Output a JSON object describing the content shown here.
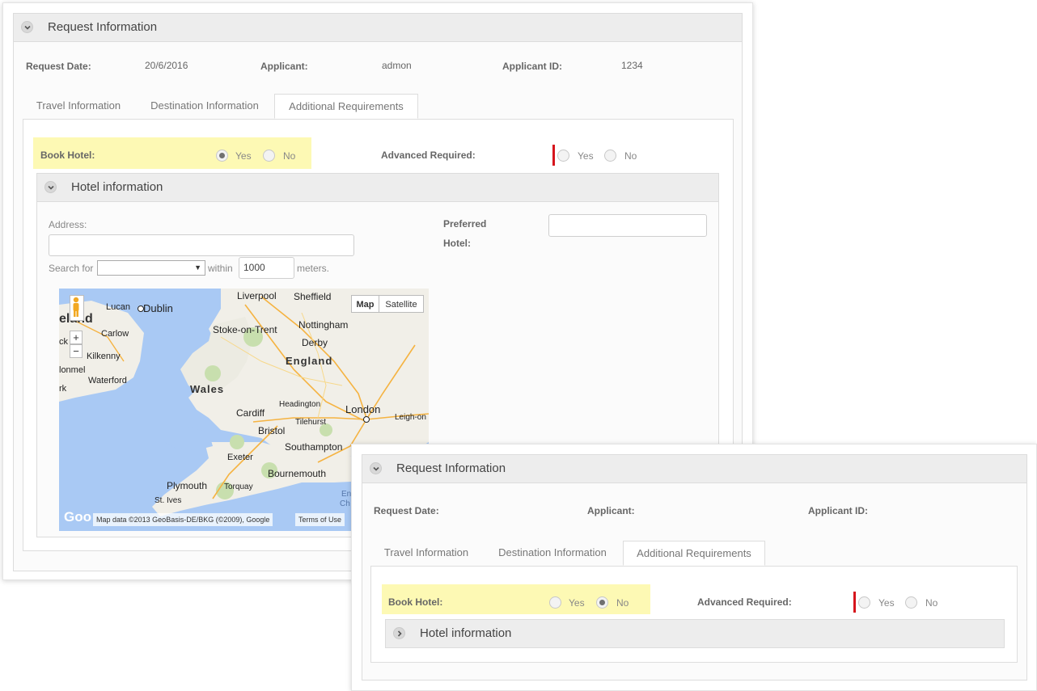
{
  "back": {
    "section_title": "Request Information",
    "fields": {
      "request_date_label": "Request Date:",
      "request_date_value": "20/6/2016",
      "applicant_label": "Applicant:",
      "applicant_value": "admon",
      "applicant_id_label": "Applicant ID:",
      "applicant_id_value": "1234"
    },
    "tabs": [
      "Travel Information",
      "Destination Information",
      "Additional Requirements"
    ],
    "active_tab": "Additional Requirements",
    "book_hotel": {
      "label": "Book Hotel:",
      "yes": "Yes",
      "no": "No",
      "selected": "Yes"
    },
    "advanced": {
      "label": "Advanced Required:",
      "yes": "Yes",
      "no": "No",
      "selected": ""
    },
    "hotel_section": {
      "title": "Hotel information",
      "address_label": "Address:",
      "address_value": "",
      "search_for_label": "Search for",
      "search_for_value": "",
      "within_label": "within",
      "within_value": "1000",
      "meters_label": "meters.",
      "preferred_label_line1": "Preferred",
      "preferred_label_line2": "Hotel:",
      "preferred_value": ""
    },
    "map": {
      "map_button": "Map",
      "satellite_button": "Satellite",
      "zoom_in": "+",
      "zoom_out": "−",
      "google_logo": "Goo",
      "attribution": "Map data ©2013 GeoBasis-DE/BKG (©2009), Google",
      "terms": "Terms of Use",
      "cities": {
        "lucan": "Lucan",
        "dublin": "Dublin",
        "ireland": "eland",
        "carlow": "Carlow",
        "ck": "ck",
        "kilkenny": "Kilkenny",
        "clonmel": "lonmel",
        "waterford": "Waterford",
        "rk": "rk",
        "liverpool": "Liverpool",
        "sheffield": "Sheffield",
        "stoke": "Stoke-on-Trent",
        "nottingham": "Nottingham",
        "derby": "Derby",
        "england": "England",
        "wales": "Wales",
        "headington": "Headington",
        "cardiff": "Cardiff",
        "tilehurst": "Tilehurst",
        "london": "London",
        "leigh": "Leigh-on",
        "bristol": "Bristol",
        "southampton": "Southampton",
        "exeter": "Exeter",
        "bournemouth": "Bournemouth",
        "plymouth": "Plymouth",
        "torquay": "Torquay",
        "stives": "St. Ives",
        "en": "En",
        "ch": "Ch"
      }
    }
  },
  "front": {
    "section_title": "Request Information",
    "fields": {
      "request_date_label": "Request Date:",
      "applicant_label": "Applicant:",
      "applicant_id_label": "Applicant ID:"
    },
    "tabs": [
      "Travel Information",
      "Destination Information",
      "Additional Requirements"
    ],
    "active_tab": "Additional Requirements",
    "book_hotel": {
      "label": "Book Hotel:",
      "yes": "Yes",
      "no": "No",
      "selected": "No"
    },
    "advanced": {
      "label": "Advanced Required:",
      "yes": "Yes",
      "no": "No",
      "selected": ""
    },
    "hotel_section": {
      "title": "Hotel information"
    }
  },
  "colors": {
    "highlight": "#fdf9b4",
    "required_marker": "#d6141c",
    "panel_header": "#ededed"
  }
}
